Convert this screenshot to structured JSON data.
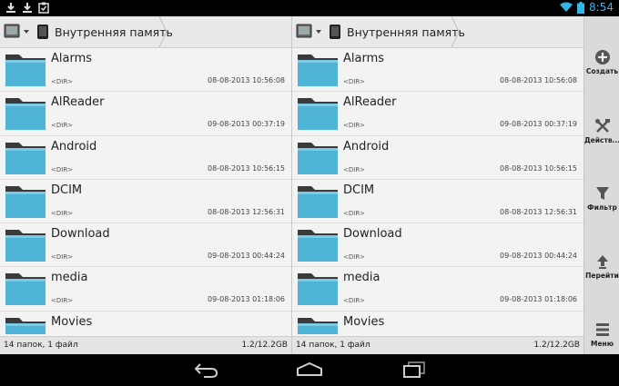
{
  "status_bar": {
    "time": "8:54",
    "icons": [
      "download-icon",
      "download-icon",
      "clipboard-check-icon",
      "wifi-icon",
      "battery-icon"
    ]
  },
  "panes": [
    {
      "path": "Внутренняя память",
      "files": [
        {
          "name": "Alarms",
          "type": "<DIR>",
          "date": "08-08-2013 10:56:08"
        },
        {
          "name": "AlReader",
          "type": "<DIR>",
          "date": "09-08-2013 00:37:19"
        },
        {
          "name": "Android",
          "type": "<DIR>",
          "date": "08-08-2013 10:56:15"
        },
        {
          "name": "DCIM",
          "type": "<DIR>",
          "date": "08-08-2013 12:56:31"
        },
        {
          "name": "Download",
          "type": "<DIR>",
          "date": "09-08-2013 00:44:24"
        },
        {
          "name": "media",
          "type": "<DIR>",
          "date": "09-08-2013 01:18:06"
        },
        {
          "name": "Movies",
          "type": "",
          "date": ""
        }
      ],
      "footer_count": "14 папок, 1 файл",
      "footer_size": "1.2/12.2GB"
    },
    {
      "path": "Внутренняя память",
      "files": [
        {
          "name": "Alarms",
          "type": "<DIR>",
          "date": "08-08-2013 10:56:08"
        },
        {
          "name": "AlReader",
          "type": "<DIR>",
          "date": "09-08-2013 00:37:19"
        },
        {
          "name": "Android",
          "type": "<DIR>",
          "date": "08-08-2013 10:56:15"
        },
        {
          "name": "DCIM",
          "type": "<DIR>",
          "date": "08-08-2013 12:56:31"
        },
        {
          "name": "Download",
          "type": "<DIR>",
          "date": "09-08-2013 00:44:24"
        },
        {
          "name": "media",
          "type": "<DIR>",
          "date": "09-08-2013 01:18:06"
        },
        {
          "name": "Movies",
          "type": "",
          "date": ""
        }
      ],
      "footer_count": "14 папок, 1 файл",
      "footer_size": "1.2/12.2GB"
    }
  ],
  "toolbar": {
    "create": "Создать",
    "actions": "Действ...",
    "filter": "Фильтр",
    "goto": "Перейти",
    "menu": "Меню"
  },
  "colors": {
    "accent": "#33b5e5",
    "folder_body": "#4fb3d6",
    "folder_tab": "#3a3a3a"
  }
}
